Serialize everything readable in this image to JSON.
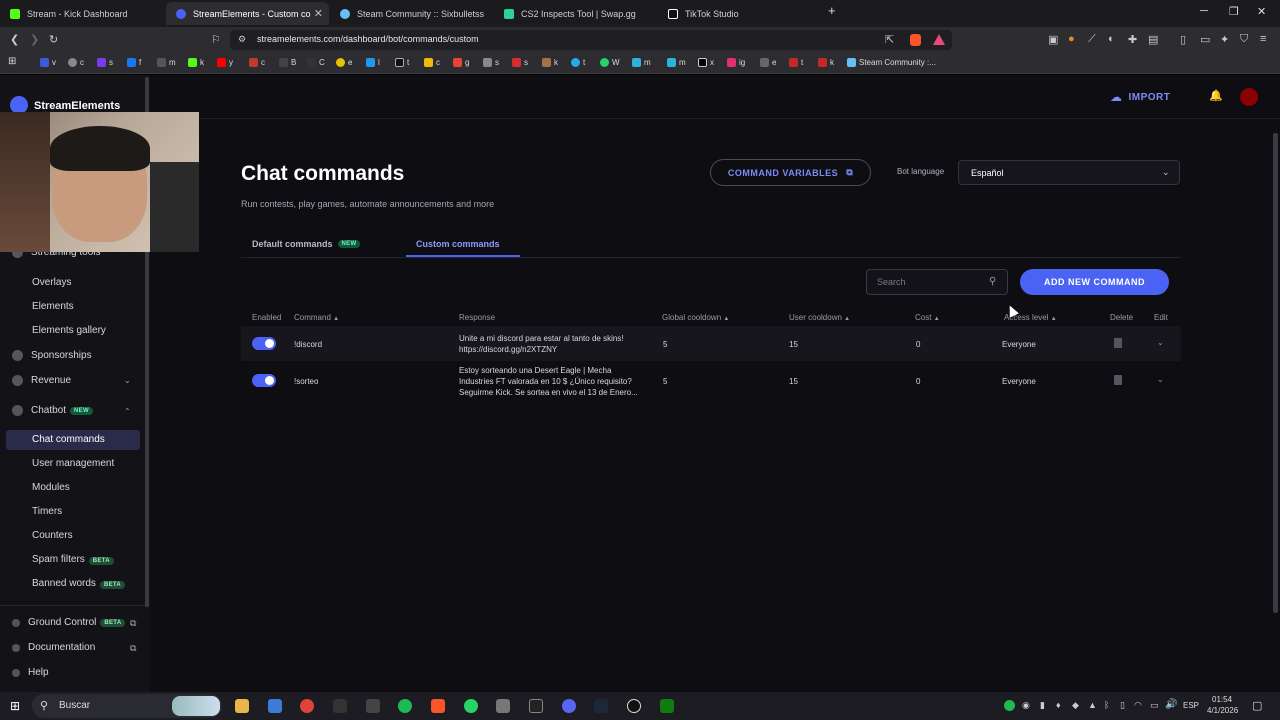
{
  "browser": {
    "tabs": [
      {
        "title": "Stream - Kick Dashboard",
        "color": "#53fc18"
      },
      {
        "title": "StreamElements - Custom comm",
        "color": "#4a63f4"
      },
      {
        "title": "Steam Community :: Sixbulletss Store",
        "color": "#66c0f4"
      },
      {
        "title": "CS2 Inspects Tool | Swap.gg",
        "color": "#2ad39a"
      },
      {
        "title": "TikTok Studio",
        "color": "#ffffff"
      }
    ],
    "url": "streamelements.com/dashboard/bot/commands/custom",
    "bookmarks": [
      "v",
      "c",
      "s",
      "f",
      "m",
      "k",
      "y",
      "c",
      "B",
      "C",
      "e",
      "l",
      "t",
      "c",
      "g",
      "s",
      "s",
      "k",
      "t",
      "W",
      "m",
      "m",
      "x",
      "ig",
      "e",
      "t",
      "k",
      "Steam Community :..."
    ]
  },
  "brand": "StreamElements",
  "header": {
    "import_label": "IMPORT"
  },
  "sidebar": {
    "streaming_tools": "Streaming tools",
    "overlays": "Overlays",
    "elements": "Elements",
    "elements_gallery": "Elements gallery",
    "sponsorships": "Sponsorships",
    "revenue": "Revenue",
    "chatbot": "Chatbot",
    "chatbot_badge": "NEW",
    "chat_commands": "Chat commands",
    "user_management": "User management",
    "modules": "Modules",
    "timers": "Timers",
    "counters": "Counters",
    "spam_filters": "Spam filters",
    "spam_badge": "BETA",
    "banned_words": "Banned words",
    "banned_badge": "BETA",
    "ground_control": "Ground Control",
    "ground_badge": "BETA",
    "documentation": "Documentation",
    "help": "Help"
  },
  "page": {
    "title": "Chat commands",
    "subtitle": "Run contests, play games, automate announcements and more",
    "command_variables": "COMMAND VARIABLES",
    "bot_language_label": "Bot language",
    "bot_language_value": "Español",
    "tab_default": "Default commands",
    "tab_default_badge": "NEW",
    "tab_custom": "Custom commands",
    "search_placeholder": "Search",
    "add_button": "ADD NEW COMMAND"
  },
  "table": {
    "headers": {
      "enabled": "Enabled",
      "command": "Command",
      "response": "Response",
      "global_cooldown": "Global cooldown",
      "user_cooldown": "User cooldown",
      "cost": "Cost",
      "access_level": "Access level",
      "delete": "Delete",
      "edit": "Edit"
    },
    "rows": [
      {
        "command": "!discord",
        "response_line1": "Unite a mi discord para estar al tanto de skins!",
        "response_line2": "https://discord.gg/n2XTZNY",
        "response_line3": "",
        "global_cooldown": "5",
        "user_cooldown": "15",
        "cost": "0",
        "access": "Everyone",
        "enabled": true
      },
      {
        "command": "!sorteo",
        "response_line1": "Estoy sorteando una Desert Eagle | Mecha",
        "response_line2": "Industries FT valorada en 10 $ ¿Único requisito?",
        "response_line3": "Seguirme Kick. Se sortea en vivo el 13 de Enero...",
        "global_cooldown": "5",
        "user_cooldown": "15",
        "cost": "0",
        "access": "Everyone",
        "enabled": true
      }
    ]
  },
  "taskbar": {
    "search": "Buscar",
    "lang": "ESP",
    "time": "01:54",
    "date": "4/1/2026"
  },
  "colors": {
    "accent": "#4a63f4",
    "background": "#0e0e12",
    "sidebar": "#131317"
  }
}
